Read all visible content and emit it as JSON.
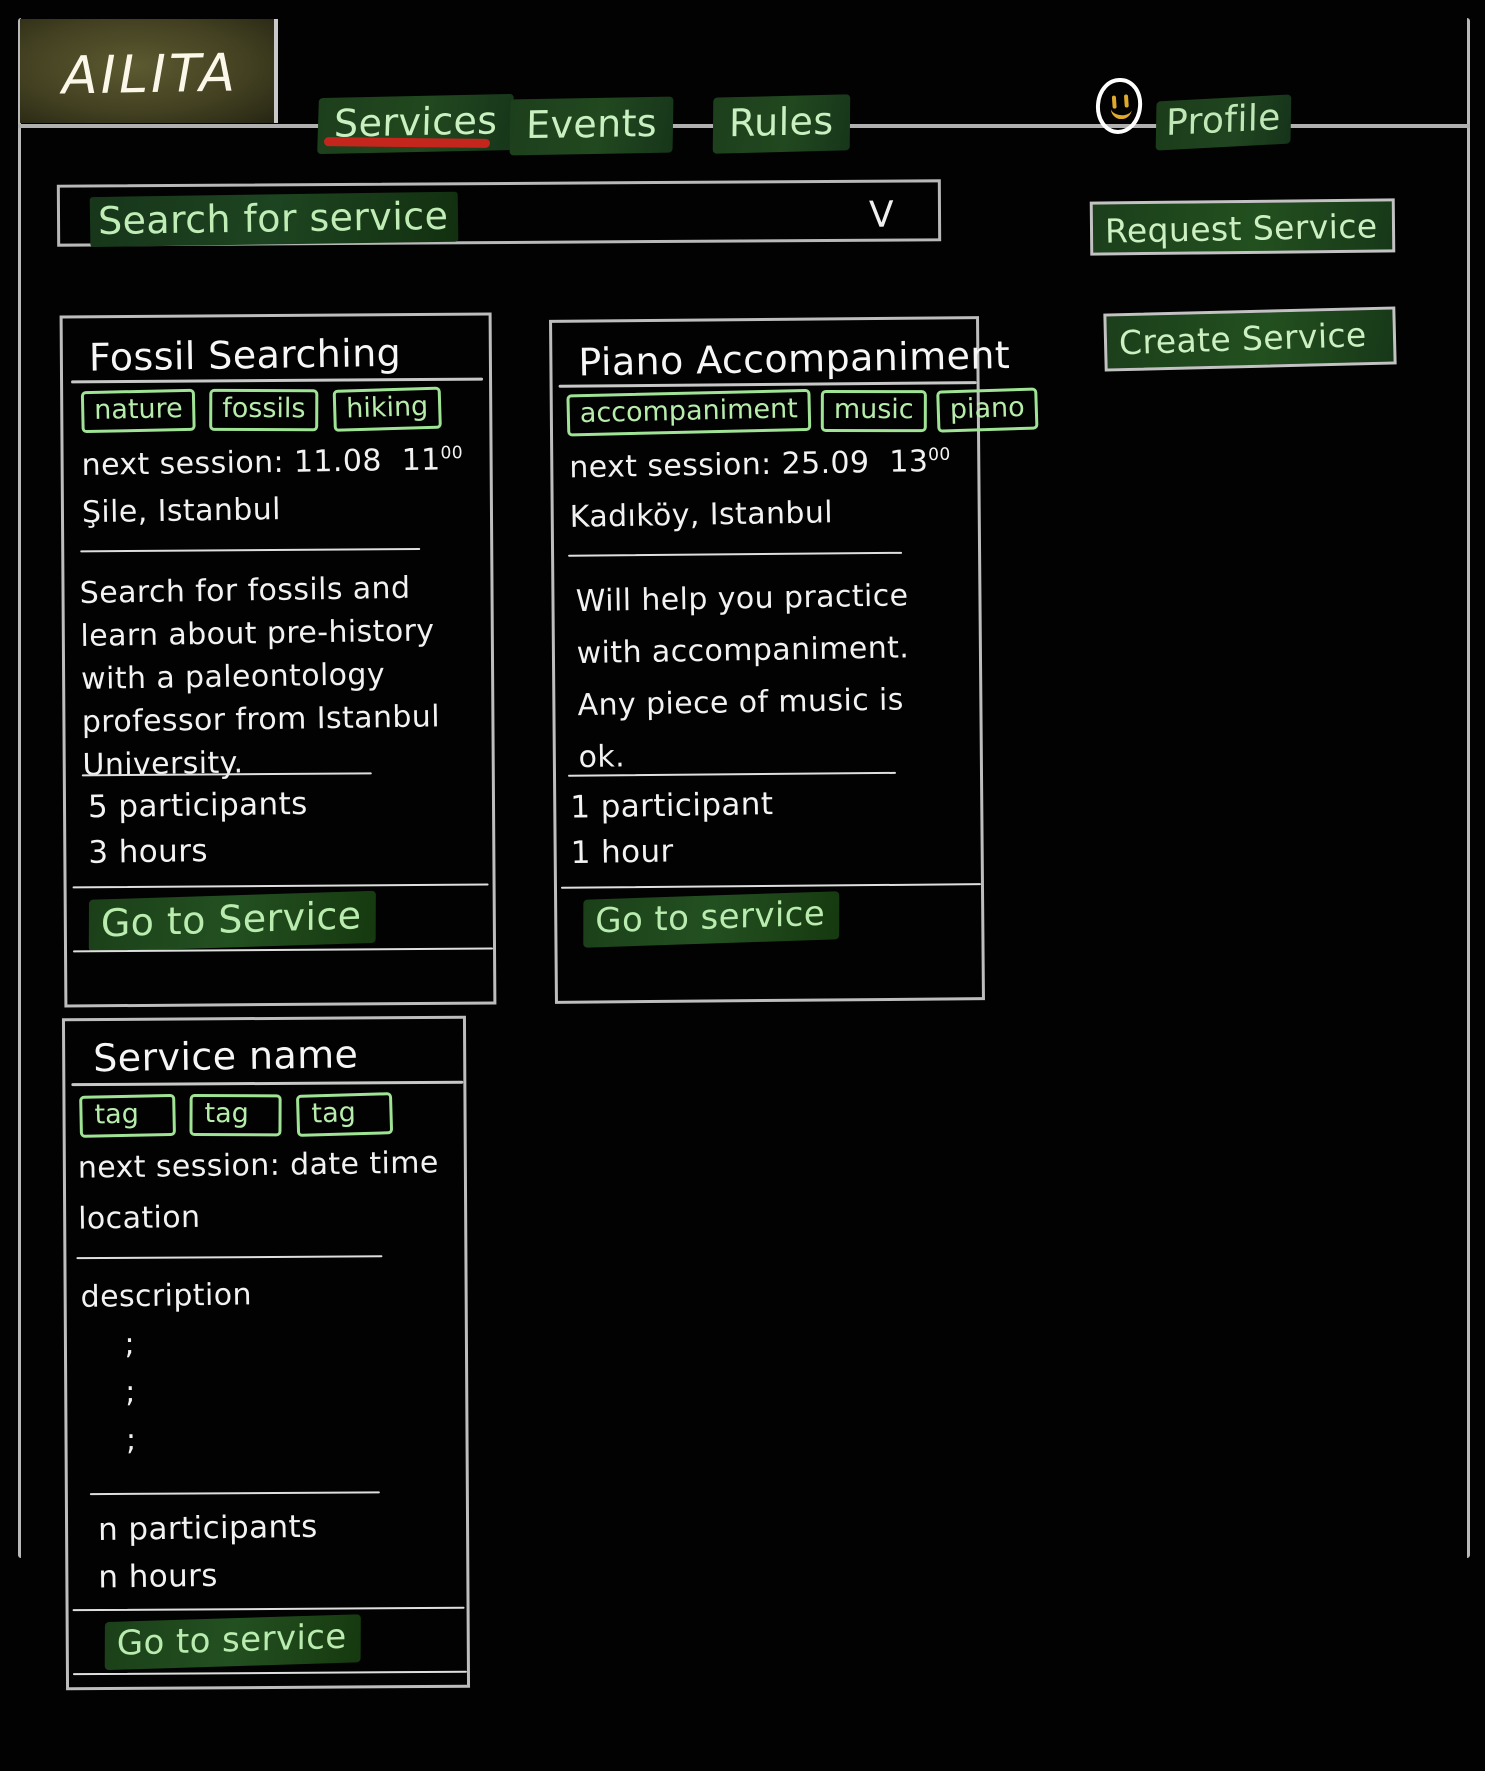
{
  "app": {
    "logo": "AILITA"
  },
  "nav": {
    "tabs": [
      {
        "label": "Services",
        "active": true
      },
      {
        "label": "Events",
        "active": false
      },
      {
        "label": "Rules",
        "active": false
      }
    ],
    "profile_label": "Profile",
    "avatar_icon": "smiley-face-icon"
  },
  "search": {
    "placeholder": "Search for service",
    "dropdown_icon": "chevron-down-icon",
    "dropdown_glyph": "V"
  },
  "actions": {
    "request_service": "Request Service",
    "create_service": "Create Service"
  },
  "cards": [
    {
      "title": "Fossil Searching",
      "tags": [
        "nature",
        "fossils",
        "hiking"
      ],
      "session_label": "next session:",
      "session_date": "11.08",
      "session_time_hour": "11",
      "session_time_min": "00",
      "location": "Şile, Istanbul",
      "description": [
        "Search for fossils and",
        "learn about pre-history",
        "with a paleontology",
        "professor from Istanbul",
        "University."
      ],
      "participants": "5 participants",
      "duration": "3 hours",
      "cta": "Go to Service"
    },
    {
      "title": "Piano Accompaniment",
      "tags": [
        "accompaniment",
        "music",
        "piano"
      ],
      "session_label": "next session:",
      "session_date": "25.09",
      "session_time_hour": "13",
      "session_time_min": "00",
      "location": "Kadıköy, Istanbul",
      "description": [
        "Will help you practice",
        "with accompaniment.",
        "Any piece of music is",
        "ok."
      ],
      "participants": "1 participant",
      "duration": "1 hour",
      "cta": "Go to service"
    },
    {
      "title": "Service name",
      "tags": [
        "tag",
        "tag",
        "tag"
      ],
      "session_line": "next session: date time",
      "location": "location",
      "description_label": "description",
      "description_bullets": [
        ";",
        ";",
        ";"
      ],
      "participants": "n participants",
      "duration": "n hours",
      "cta": "Go to service"
    }
  ]
}
